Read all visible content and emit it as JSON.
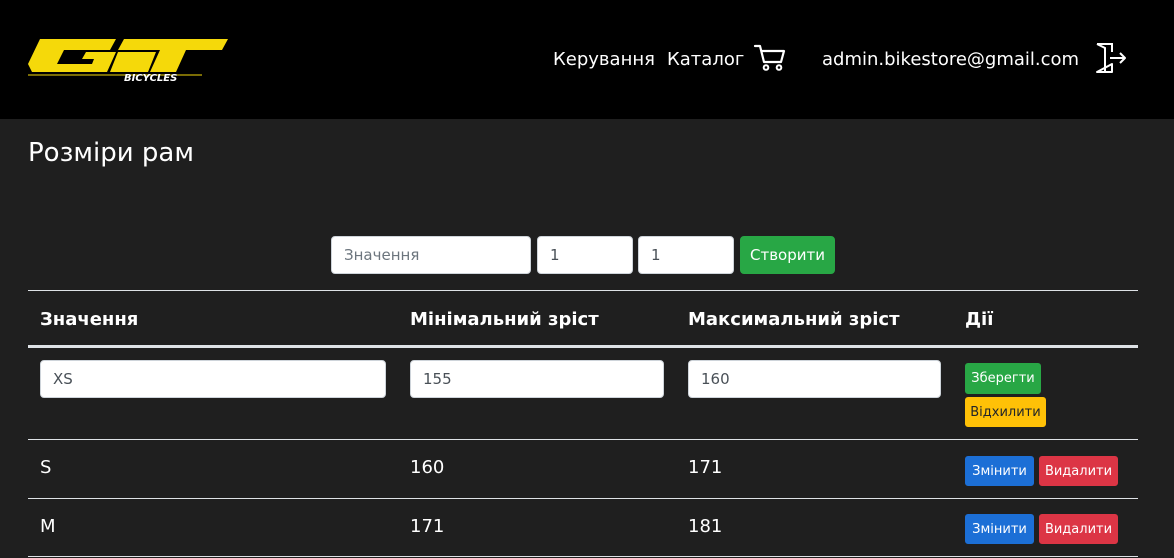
{
  "header": {
    "logo_text": "BICYCLES",
    "nav": [
      {
        "label": "Керування"
      },
      {
        "label": "Каталог"
      }
    ],
    "user_email": "admin.bikestore@gmail.com",
    "icons": [
      "cart-icon",
      "logout-icon"
    ]
  },
  "page": {
    "title": "Розміри рам"
  },
  "create_form": {
    "value_placeholder": "Значення",
    "min_value": "1",
    "max_value": "1",
    "create_label": "Створити"
  },
  "table": {
    "headers": [
      "Значення",
      "Мінімальний зріст",
      "Максимальний зріст",
      "Дії"
    ],
    "edit_row": {
      "value": "XS",
      "min": "155",
      "max": "160",
      "save_label": "Зберегти",
      "cancel_label": "Відхилити"
    },
    "rows": [
      {
        "value": "S",
        "min": "160",
        "max": "171",
        "edit_label": "Змінити",
        "delete_label": "Видалити"
      },
      {
        "value": "M",
        "min": "171",
        "max": "181",
        "edit_label": "Змінити",
        "delete_label": "Видалити"
      }
    ]
  },
  "colors": {
    "header_bg": "#000000",
    "page_bg": "#1f1f1f",
    "logo_yellow": "#f5d90a",
    "success": "#28a745",
    "warning": "#ffc107",
    "primary": "#1c6fd6",
    "danger": "#dc3545"
  }
}
